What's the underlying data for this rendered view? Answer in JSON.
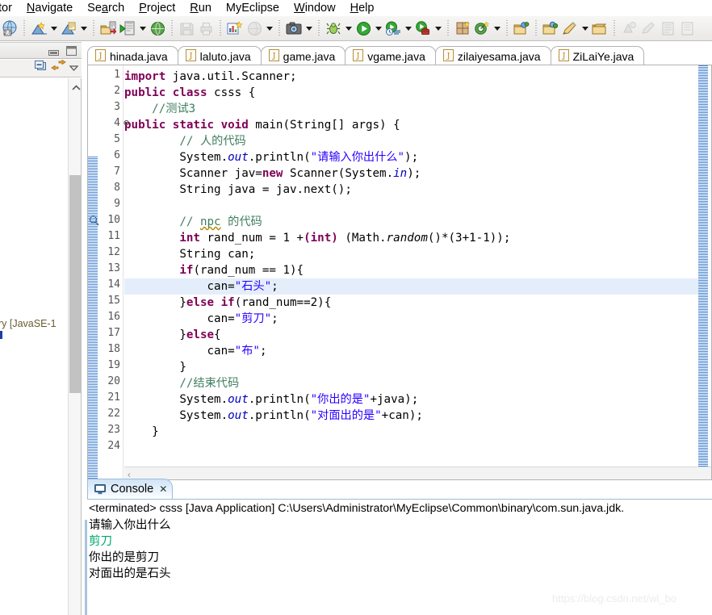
{
  "menu": {
    "items": [
      {
        "pre": "tor",
        "mnemonic": "",
        "post": "",
        "clipped": true
      },
      {
        "pre": "",
        "mnemonic": "N",
        "post": "avigate"
      },
      {
        "pre": "Se",
        "mnemonic": "a",
        "post": "rch"
      },
      {
        "pre": "",
        "mnemonic": "P",
        "post": "roject"
      },
      {
        "pre": "",
        "mnemonic": "R",
        "post": "un"
      },
      {
        "pre": "MyEclipse",
        "mnemonic": "",
        "post": ""
      },
      {
        "pre": "",
        "mnemonic": "W",
        "post": "indow"
      },
      {
        "pre": "",
        "mnemonic": "H",
        "post": "elp"
      }
    ]
  },
  "toolbar": {
    "buttons": [
      {
        "name": "myeclipse-2.0-icon",
        "kind": "icon",
        "glyph": "globe2"
      },
      {
        "name": "separator",
        "kind": "sep"
      },
      {
        "name": "new-wizard-icon",
        "kind": "icon",
        "glyph": "newwiz"
      },
      {
        "name": "new-wizard-dropdown",
        "kind": "arrow"
      },
      {
        "name": "new-project-icon",
        "kind": "icon",
        "glyph": "newproj"
      },
      {
        "name": "new-project-dropdown",
        "kind": "arrow"
      },
      {
        "name": "separator",
        "kind": "sep"
      },
      {
        "name": "import-icon",
        "kind": "icon",
        "glyph": "import"
      },
      {
        "name": "deploy-icon",
        "kind": "icon",
        "glyph": "deploy"
      },
      {
        "name": "deploy-dropdown",
        "kind": "arrow"
      },
      {
        "name": "browser-icon",
        "kind": "icon",
        "glyph": "globe"
      },
      {
        "name": "separator",
        "kind": "sep"
      },
      {
        "name": "save-icon-disabled",
        "kind": "icon",
        "glyph": "save-dis"
      },
      {
        "name": "print-icon-disabled",
        "kind": "icon",
        "glyph": "print-dis"
      },
      {
        "name": "separator",
        "kind": "sep"
      },
      {
        "name": "new-report-icon",
        "kind": "icon",
        "glyph": "report"
      },
      {
        "name": "web-browser-icon-disabled",
        "kind": "icon",
        "glyph": "webdis"
      },
      {
        "name": "web-browser-dropdown",
        "kind": "arrow"
      },
      {
        "name": "separator",
        "kind": "sep"
      },
      {
        "name": "snapshot-icon",
        "kind": "icon",
        "glyph": "camera"
      },
      {
        "name": "snapshot-dropdown",
        "kind": "arrow"
      },
      {
        "name": "separator",
        "kind": "sep"
      },
      {
        "name": "debug-icon",
        "kind": "icon",
        "glyph": "bug"
      },
      {
        "name": "debug-dropdown",
        "kind": "arrow"
      },
      {
        "name": "run-icon",
        "kind": "icon",
        "glyph": "run"
      },
      {
        "name": "run-dropdown",
        "kind": "arrow"
      },
      {
        "name": "run-history-icon",
        "kind": "icon",
        "glyph": "runhist"
      },
      {
        "name": "run-history-dropdown",
        "kind": "arrow"
      },
      {
        "name": "external-tools-icon",
        "kind": "icon",
        "glyph": "exttools"
      },
      {
        "name": "external-tools-dropdown",
        "kind": "arrow"
      },
      {
        "name": "separator",
        "kind": "sep"
      },
      {
        "name": "new-package-icon",
        "kind": "icon",
        "glyph": "package"
      },
      {
        "name": "new-annotation-icon",
        "kind": "icon",
        "glyph": "annot"
      },
      {
        "name": "new-annotation-dropdown",
        "kind": "arrow"
      },
      {
        "name": "separator",
        "kind": "sep"
      },
      {
        "name": "open-type-icon",
        "kind": "icon",
        "glyph": "opentype"
      },
      {
        "name": "separator",
        "kind": "sep"
      },
      {
        "name": "open-task-icon",
        "kind": "icon",
        "glyph": "opentask"
      },
      {
        "name": "new-task-icon",
        "kind": "icon",
        "glyph": "pencil"
      },
      {
        "name": "new-task-dropdown",
        "kind": "arrow"
      },
      {
        "name": "open-folder-icon",
        "kind": "icon",
        "glyph": "folder"
      },
      {
        "name": "separator",
        "kind": "sep"
      },
      {
        "name": "previous-annotation-icon-disabled",
        "kind": "icon",
        "glyph": "prevann"
      },
      {
        "name": "next-annotation-icon-disabled",
        "kind": "icon",
        "glyph": "nextann"
      },
      {
        "name": "toggle-block-selection-icon-disabled",
        "kind": "icon",
        "glyph": "block"
      },
      {
        "name": "last-edit-icon-disabled",
        "kind": "icon",
        "glyph": "lastedit"
      }
    ]
  },
  "left_panel": {
    "fragment_text": "ry [JavaSE-1"
  },
  "editor": {
    "tabs": [
      {
        "label": "hinada.java",
        "active": false
      },
      {
        "label": "laluto.java",
        "active": false
      },
      {
        "label": "game.java",
        "active": false
      },
      {
        "label": "vgame.java",
        "active": false
      },
      {
        "label": "zilaiyesama.java",
        "active": false
      },
      {
        "label": "ZiLaiYe.java",
        "active": true
      }
    ],
    "highlight_line": 14,
    "lines": [
      {
        "n": 1,
        "fold": "",
        "html": "<span class=\"kw\">import</span> java.util.Scanner;"
      },
      {
        "n": 2,
        "fold": "",
        "html": "<span class=\"kw\">public</span> <span class=\"kw\">class</span> csss {"
      },
      {
        "n": 3,
        "fold": "",
        "html": "    <span class=\"cmt\">//测试3</span>"
      },
      {
        "n": 4,
        "fold": "⊖",
        "html": "<span class=\"kw\">public</span> <span class=\"kw\">static</span> <span class=\"kw\">void</span> main(String[] args) {"
      },
      {
        "n": 5,
        "fold": "",
        "html": "        <span class=\"cmt\">// 人的代码</span>"
      },
      {
        "n": 6,
        "fold": "",
        "html": "        System.<span class=\"fld\">out</span>.println(<span class=\"str\">\"请输入你出什么\"</span>);"
      },
      {
        "n": 7,
        "fold": "",
        "html": "        Scanner jav=<span class=\"kw\">new</span> Scanner(System.<span class=\"fld\">in</span>);"
      },
      {
        "n": 8,
        "fold": "",
        "html": "        String java = jav.next();"
      },
      {
        "n": 9,
        "fold": "",
        "html": ""
      },
      {
        "n": 10,
        "fold": "",
        "html": "        <span class=\"cmt\">// <span class=\"squig\">npc</span> 的代码</span>"
      },
      {
        "n": 11,
        "fold": "",
        "html": "        <span class=\"kw\">int</span> rand_num = 1 +<span class=\"kw\">(int)</span> (Math.<span class=\"stc\">random</span>()*(3+1-1));"
      },
      {
        "n": 12,
        "fold": "",
        "html": "        String can;"
      },
      {
        "n": 13,
        "fold": "",
        "html": "        <span class=\"kw\">if</span>(rand_num == 1){"
      },
      {
        "n": 14,
        "fold": "",
        "html": "            can=<span class=\"str\">\"石头\"</span>;"
      },
      {
        "n": 15,
        "fold": "",
        "html": "        }<span class=\"kw\">else</span> <span class=\"kw\">if</span>(rand_num==2){"
      },
      {
        "n": 16,
        "fold": "",
        "html": "            can=<span class=\"str\">\"剪刀\"</span>;"
      },
      {
        "n": 17,
        "fold": "",
        "html": "        }<span class=\"kw\">else</span>{"
      },
      {
        "n": 18,
        "fold": "",
        "html": "            can=<span class=\"str\">\"布\"</span>;"
      },
      {
        "n": 19,
        "fold": "",
        "html": "        }"
      },
      {
        "n": 20,
        "fold": "",
        "html": "        <span class=\"cmt\">//结束代码</span>"
      },
      {
        "n": 21,
        "fold": "",
        "html": "        System.<span class=\"fld\">out</span>.println(<span class=\"str\">\"你出的是\"</span>+java);"
      },
      {
        "n": 22,
        "fold": "",
        "html": "        System.<span class=\"fld\">out</span>.println(<span class=\"str\">\"对面出的是\"</span>+can);"
      },
      {
        "n": 23,
        "fold": "",
        "html": "    }"
      },
      {
        "n": 24,
        "fold": "",
        "html": ""
      }
    ],
    "plain_lines": [
      "import java.util.Scanner;",
      "public class csss {",
      "    //测试3",
      "public static void main(String[] args) {",
      "        // 人的代码",
      "        System.out.println(\"请输入你出什么\");",
      "        Scanner jav=new Scanner(System.in);",
      "        String java = jav.next();",
      "",
      "        // npc 的代码",
      "        int rand_num = 1 +(int) (Math.random()*(3+1-1));",
      "        String can;",
      "        if(rand_num == 1){",
      "            can=\"石头\";",
      "        }else if(rand_num==2){",
      "            can=\"剪刀\";",
      "        }else{",
      "            can=\"布\";",
      "        }",
      "        //结束代码",
      "        System.out.println(\"你出的是\"+java);",
      "        System.out.println(\"对面出的是\"+can);",
      "    }",
      ""
    ],
    "hscroll_left_glyph": "‹"
  },
  "console": {
    "tab_label": "Console",
    "close_glyph": "✕",
    "launch_line": "<terminated> csss [Java Application] C:\\Users\\Administrator\\MyEclipse\\Common\\binary\\com.sun.java.jdk.",
    "output": [
      {
        "text": "请输入你出什么",
        "color": "black"
      },
      {
        "text": "剪刀",
        "color": "green"
      },
      {
        "text": "你出的是剪刀",
        "color": "black"
      },
      {
        "text": "对面出的是石头",
        "color": "black"
      }
    ],
    "colors": {
      "input_echo": "#00a86b",
      "text": "#000000"
    }
  },
  "watermark": {
    "text": "https://blog.csdn.net/wl_bo"
  },
  "colors": {
    "keyword": "#7f0055",
    "string": "#2a00ff",
    "comment": "#3f7f5f",
    "field": "#0000c0",
    "highlight_line": "#e4eefb",
    "toolbar_bg": "#f0efee"
  }
}
